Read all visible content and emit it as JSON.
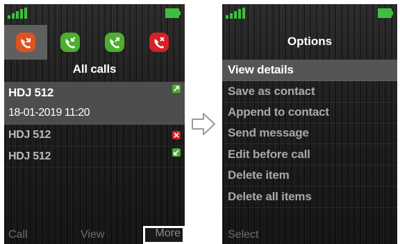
{
  "left_screen": {
    "tabs": [
      {
        "icon": "missed-calls-icon",
        "color": "#e0531d",
        "active": true
      },
      {
        "icon": "received-calls-icon",
        "color": "#4caf2f",
        "active": false
      },
      {
        "icon": "dialled-calls-icon",
        "color": "#4caf2f",
        "active": false
      },
      {
        "icon": "rejected-calls-icon",
        "color": "#d61f26",
        "active": false
      }
    ],
    "list_title": "All calls",
    "selected_entry": {
      "name": "HDJ 512",
      "datetime": "18-01-2019 11:20",
      "icon": "outgoing-call-icon"
    },
    "entries": [
      {
        "name": "HDJ 512",
        "icon": "missed-call-icon"
      },
      {
        "name": "HDJ 512",
        "icon": "incoming-call-icon"
      }
    ],
    "softkeys": {
      "left": "Call",
      "center": "View",
      "right": "More"
    }
  },
  "right_screen": {
    "title": "Options",
    "items": [
      {
        "label": "View details",
        "selected": true
      },
      {
        "label": "Save as contact",
        "selected": false
      },
      {
        "label": "Append to contact",
        "selected": false
      },
      {
        "label": "Send message",
        "selected": false
      },
      {
        "label": "Edit before call",
        "selected": false
      },
      {
        "label": "Delete item",
        "selected": false
      },
      {
        "label": "Delete all items",
        "selected": false
      }
    ],
    "softkeys": {
      "left": "Select"
    }
  },
  "colors": {
    "accent_green": "#4caf2f",
    "missed_red": "#d61f26",
    "active_orange": "#e0531d"
  }
}
